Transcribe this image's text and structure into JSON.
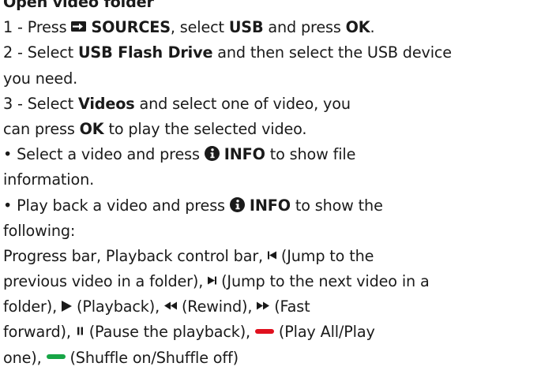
{
  "heading": "Open video folder",
  "step1": {
    "prefix": "1 - Press",
    "sources_label": "SOURCES",
    "mid": ", select",
    "usb_label": "USB",
    "and_press": "and press",
    "ok_label": "OK",
    "end": "."
  },
  "step2": {
    "prefix": "2 - Select",
    "flash_label": "USB Flash Drive",
    "rest": "and then select the USB device",
    "cont": "you need."
  },
  "step3": {
    "prefix": "3 - Select",
    "videos_label": "Videos",
    "rest": "and select one of video, you",
    "cont_prefix": "can press",
    "ok_label": "OK",
    "cont_rest": "to play the selected video."
  },
  "bullet1": {
    "prefix": "• Select a video and press",
    "info_label": "INFO",
    "rest": "to show file",
    "cont": "information."
  },
  "bullet2": {
    "prefix": "• Play back a video and press",
    "info_label": "INFO",
    "rest": "to show the",
    "cont": "following:"
  },
  "controls": {
    "bars_text": "Progress bar, Playback control bar,",
    "prev_text": "(Jump to the",
    "prev_text2": "previous video in a folder),",
    "next_text": "(Jump to the next video in a",
    "next_text2": "folder),",
    "play_text": "(Playback),",
    "rewind_text": "(Rewind),",
    "ff_text": "(Fast",
    "ff_text2": "forward),",
    "pause_text": "(Pause the playback),",
    "red_text": "(Play All/Play",
    "red_text2": "one),",
    "green_text": "(Shuffle on/Shuffle off)"
  },
  "icons": {
    "sources": "sources-icon",
    "info": "info-icon",
    "previous": "skip-previous-icon",
    "next": "skip-next-icon",
    "play": "play-icon",
    "rewind": "rewind-icon",
    "fast_forward": "fast-forward-icon",
    "pause": "pause-icon"
  },
  "colors": {
    "text": "#1a1a1a",
    "red_button": "#e0101e",
    "green_button": "#17a546"
  }
}
